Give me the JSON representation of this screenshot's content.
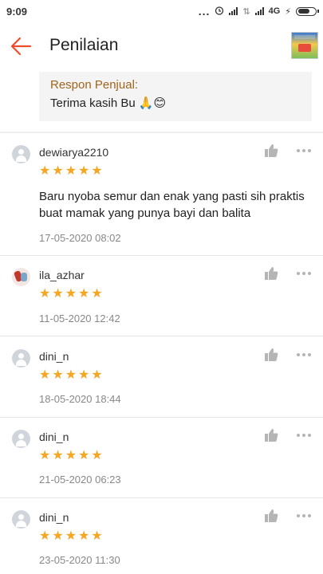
{
  "status_bar": {
    "time": "9:09",
    "dots": "...",
    "network": "4G"
  },
  "header": {
    "title": "Penilaian"
  },
  "seller_response": {
    "label": "Respon Penjual:",
    "text": "Terima kasih Bu 🙏😊"
  },
  "reviews": [
    {
      "username": "dewiarya2210",
      "rating": 5,
      "text": "Baru nyoba semur dan enak yang pasti sih praktis buat mamak yang punya bayi dan balita",
      "date": "17-05-2020 08:02"
    },
    {
      "username": "ila_azhar",
      "rating": 5,
      "date": "11-05-2020 12:42"
    },
    {
      "username": "dini_n",
      "rating": 5,
      "date": "18-05-2020 18:44"
    },
    {
      "username": "dini_n",
      "rating": 5,
      "date": "21-05-2020 06:23"
    },
    {
      "username": "dini_n",
      "rating": 5,
      "date": "23-05-2020 11:30"
    }
  ],
  "icons": {
    "back": "back-arrow-icon",
    "like": "thumbs-up-icon",
    "more": "more-options-icon",
    "star": "star-icon",
    "avatar": "default-avatar-icon"
  },
  "colors": {
    "accent": "#ee4d2d",
    "star": "#f5a623",
    "response_label": "#a0651c"
  }
}
